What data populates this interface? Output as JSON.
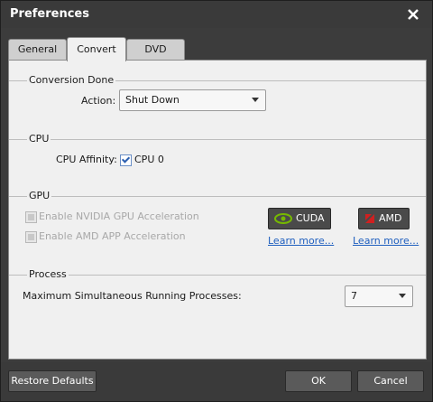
{
  "window": {
    "title": "Preferences"
  },
  "tabs": [
    {
      "label": "General"
    },
    {
      "label": "Convert"
    },
    {
      "label": "DVD"
    }
  ],
  "conversion_done": {
    "title": "Conversion Done",
    "action_label": "Action:",
    "action_value": "Shut Down"
  },
  "cpu": {
    "title": "CPU",
    "affinity_label": "CPU Affinity:",
    "cpu0_label": "CPU 0",
    "cpu0_checked": true
  },
  "gpu": {
    "title": "GPU",
    "nvidia_label": "Enable NVIDIA GPU Acceleration",
    "amd_label": "Enable AMD APP Acceleration",
    "cuda_button": "CUDA",
    "amd_button": "AMD",
    "learn_more_cuda": "Learn more...",
    "learn_more_amd": "Learn more..."
  },
  "process": {
    "title": "Process",
    "max_label": "Maximum Simultaneous Running Processes:",
    "max_value": "7"
  },
  "footer": {
    "restore": "Restore Defaults",
    "ok": "OK",
    "cancel": "Cancel"
  },
  "colors": {
    "nvidia_green": "#76b900",
    "amd_red": "#d02020",
    "link_blue": "#1f5fbf"
  }
}
